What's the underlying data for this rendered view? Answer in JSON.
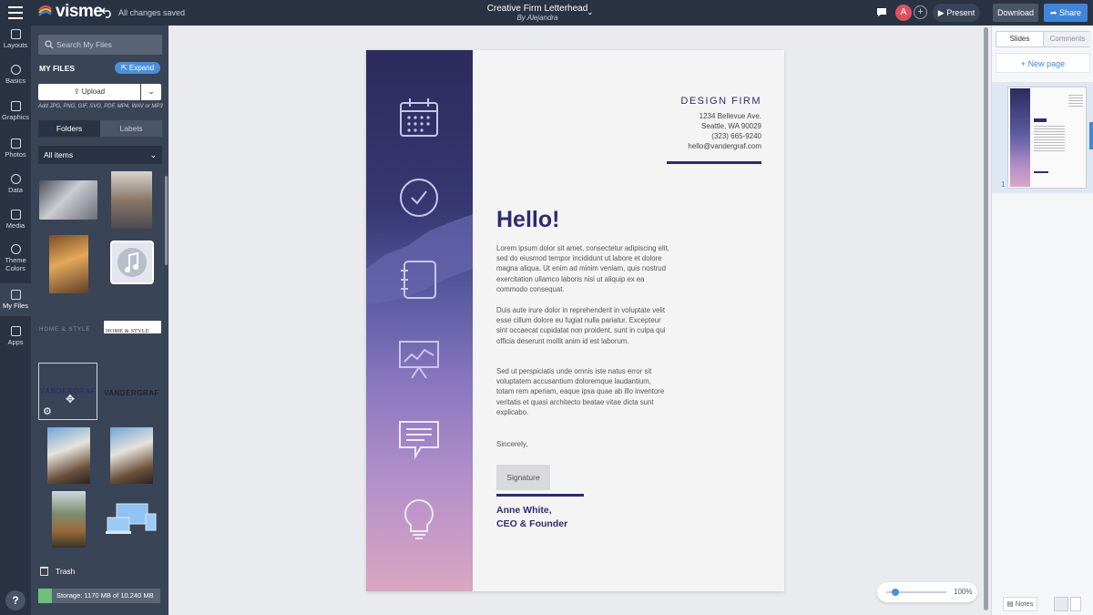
{
  "app": {
    "logo_text": "visme",
    "save_status": "All changes saved",
    "doc_title": "Creative Firm Letterhead",
    "doc_author": "By Alejandra",
    "avatar_letter": "A",
    "present_label": "Present",
    "download_label": "Download",
    "share_label": "Share",
    "accent_color": "#3f86d8",
    "chrome_color": "#2a3344"
  },
  "rail": {
    "items": [
      {
        "label": "Layouts",
        "icon": "layout-icon"
      },
      {
        "label": "Basics",
        "icon": "shapes-icon"
      },
      {
        "label": "Graphics",
        "icon": "graphics-icon"
      },
      {
        "label": "Photos",
        "icon": "photo-icon"
      },
      {
        "label": "Data",
        "icon": "pie-chart-icon"
      },
      {
        "label": "Media",
        "icon": "video-icon"
      },
      {
        "label": "Theme",
        "label2": "Colors",
        "icon": "palette-icon"
      },
      {
        "label": "My Files",
        "icon": "folder-icon"
      },
      {
        "label": "Apps",
        "icon": "apps-icon"
      }
    ],
    "help_label": "?"
  },
  "files": {
    "search_placeholder": "Search My Files",
    "title": "MY FILES",
    "expand_label": "Expand",
    "upload_label": "Upload",
    "upload_hint": "Add JPG, PNG, GIF, SVG, PDF, MP4, WAV or MP3",
    "tabs": [
      "Folders",
      "Labels"
    ],
    "filter": "All items",
    "logo_text_home": "HOME & STYLE",
    "logo_text_vandergraf": "VANDERGRAF",
    "trash_label": "Trash",
    "storage_label": "Storage: 1170 MB of 10.240 MB",
    "storage_used_fraction": 0.114
  },
  "letter": {
    "firm": "DESIGN FIRM",
    "address": [
      "1234 Bellevue Ave.",
      "Seattle, WA 90029",
      "(323) 665-9240",
      "hello@vandergraf.com"
    ],
    "greeting": "Hello!",
    "paragraphs": [
      "Lorem ipsum dolor sit amet, consectetur adipiscing elit, sed do eiusmod tempor incididunt ut labore et dolore magna aliqua. Ut enim ad minim veniam, quis nostrud exercitation ullamco laboris nisi ut aliquip ex ea commodo consequat.",
      "Duis aute irure dolor in reprehenderit in voluptate velit esse cillum dolore eu fugiat nulla pariatur. Excepteur sint occaecat cupidatat non proident, sunt in culpa qui officia deserunt mollit anim id est laborum.",
      "Sed ut perspiciatis unde omnis iste natus error sit voluptatem accusantium doloremque laudantium, totam rem aperiam, eaque ipsa quae ab illo inventore veritatis et quasi architecto beatae vitae dicta sunt explicabo."
    ],
    "closing": "Sincerely,",
    "signature_label": "Signature",
    "name": "Anne White,",
    "role": "CEO & Founder",
    "accent_color": "#2e2c6e"
  },
  "zoom": {
    "value": "100%"
  },
  "right_panel": {
    "tabs": [
      "Slides",
      "Comments"
    ],
    "new_page_label": "+ New page",
    "slide_number": "1",
    "notes_label": "Notes"
  }
}
